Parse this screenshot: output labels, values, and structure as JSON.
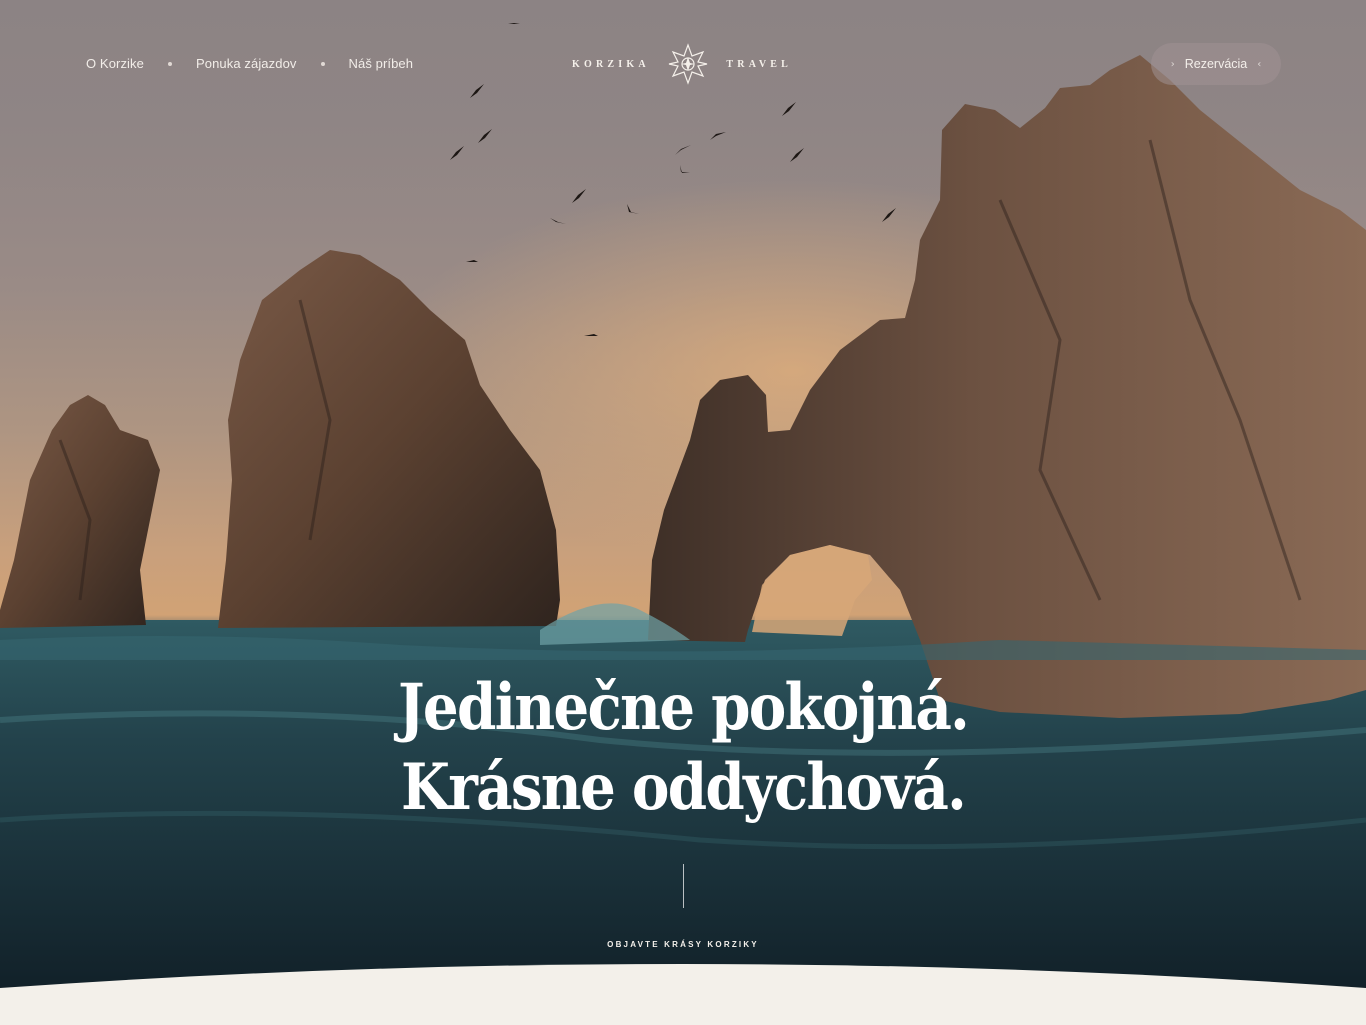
{
  "nav": {
    "links": [
      {
        "label": "O Korzike"
      },
      {
        "label": "Ponuka zájazdov"
      },
      {
        "label": "Náš príbeh"
      }
    ]
  },
  "logo": {
    "left_word": "KORZIKA",
    "right_word": "TRAVEL",
    "icon": "compass-rose-icon"
  },
  "reserve": {
    "label": "Rezervácia",
    "icon_left": "chevron-right-icon",
    "icon_right": "chevron-left-icon"
  },
  "hero": {
    "headline_line1": "Jedinečne pokojná.",
    "headline_line2": "Krásne oddychová.",
    "cta": "OBJAVTE KRÁSY KORZIKY",
    "cta_icon": "chevron-down-icon"
  },
  "colors": {
    "background": "#f3f0ea",
    "text_light": "#ffffff",
    "rock": "#5a4236",
    "sea": "#1c3038"
  }
}
